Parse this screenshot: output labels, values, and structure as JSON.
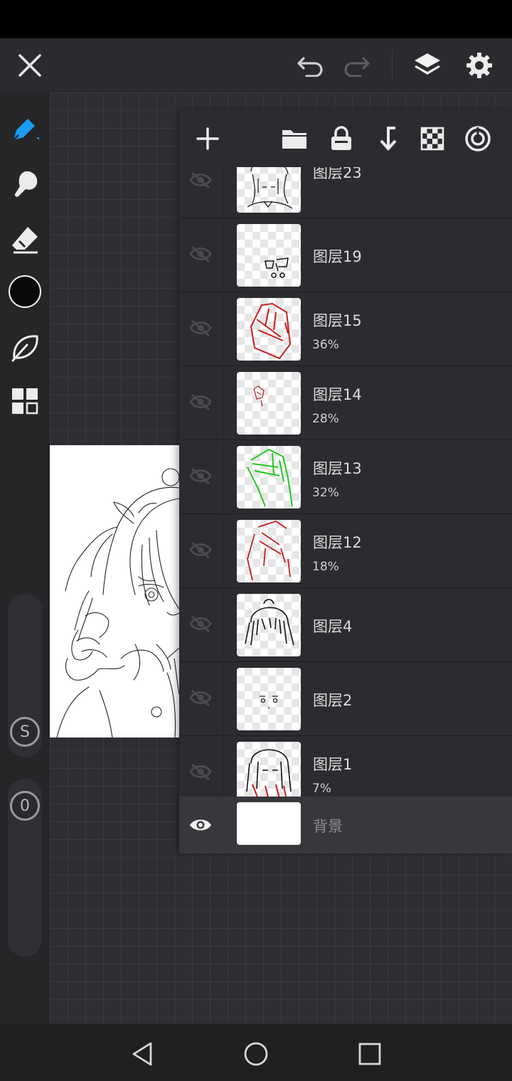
{
  "app": {
    "colors": {
      "accent": "#1a9cf2",
      "panel": "#2c2c30",
      "toolbar": "#262629",
      "current_color": "#0a0a0a"
    }
  },
  "topbar": {
    "icons": [
      "close-icon",
      "undo-icon",
      "redo-icon",
      "layers-icon",
      "settings-icon"
    ]
  },
  "left_toolbar": {
    "tools": [
      "pen-icon",
      "smudge-icon",
      "eraser-icon",
      "color-swatch",
      "leaf-icon",
      "grid-icon"
    ],
    "size_slider_label": "S",
    "opacity_slider_label": "0"
  },
  "layer_panel": {
    "toolbar_icons": [
      "add-icon",
      "folder-icon",
      "lock-icon",
      "merge-down-icon",
      "transparency-icon",
      "clipping-icon"
    ],
    "layers": [
      {
        "name": "图层23",
        "opacity": "",
        "visible": false
      },
      {
        "name": "图层19",
        "opacity": "",
        "visible": false
      },
      {
        "name": "图层15",
        "opacity": "36%",
        "visible": false
      },
      {
        "name": "图层14",
        "opacity": "28%",
        "visible": false
      },
      {
        "name": "图层13",
        "opacity": "32%",
        "visible": false
      },
      {
        "name": "图层12",
        "opacity": "18%",
        "visible": false
      },
      {
        "name": "图层4",
        "opacity": "",
        "visible": false
      },
      {
        "name": "图层2",
        "opacity": "",
        "visible": false
      },
      {
        "name": "图层1",
        "opacity": "7%",
        "visible": false
      }
    ],
    "background_layer": {
      "name": "背景",
      "visible": true
    }
  },
  "navbar": {
    "icons": [
      "back-icon",
      "home-icon",
      "recents-icon"
    ]
  }
}
